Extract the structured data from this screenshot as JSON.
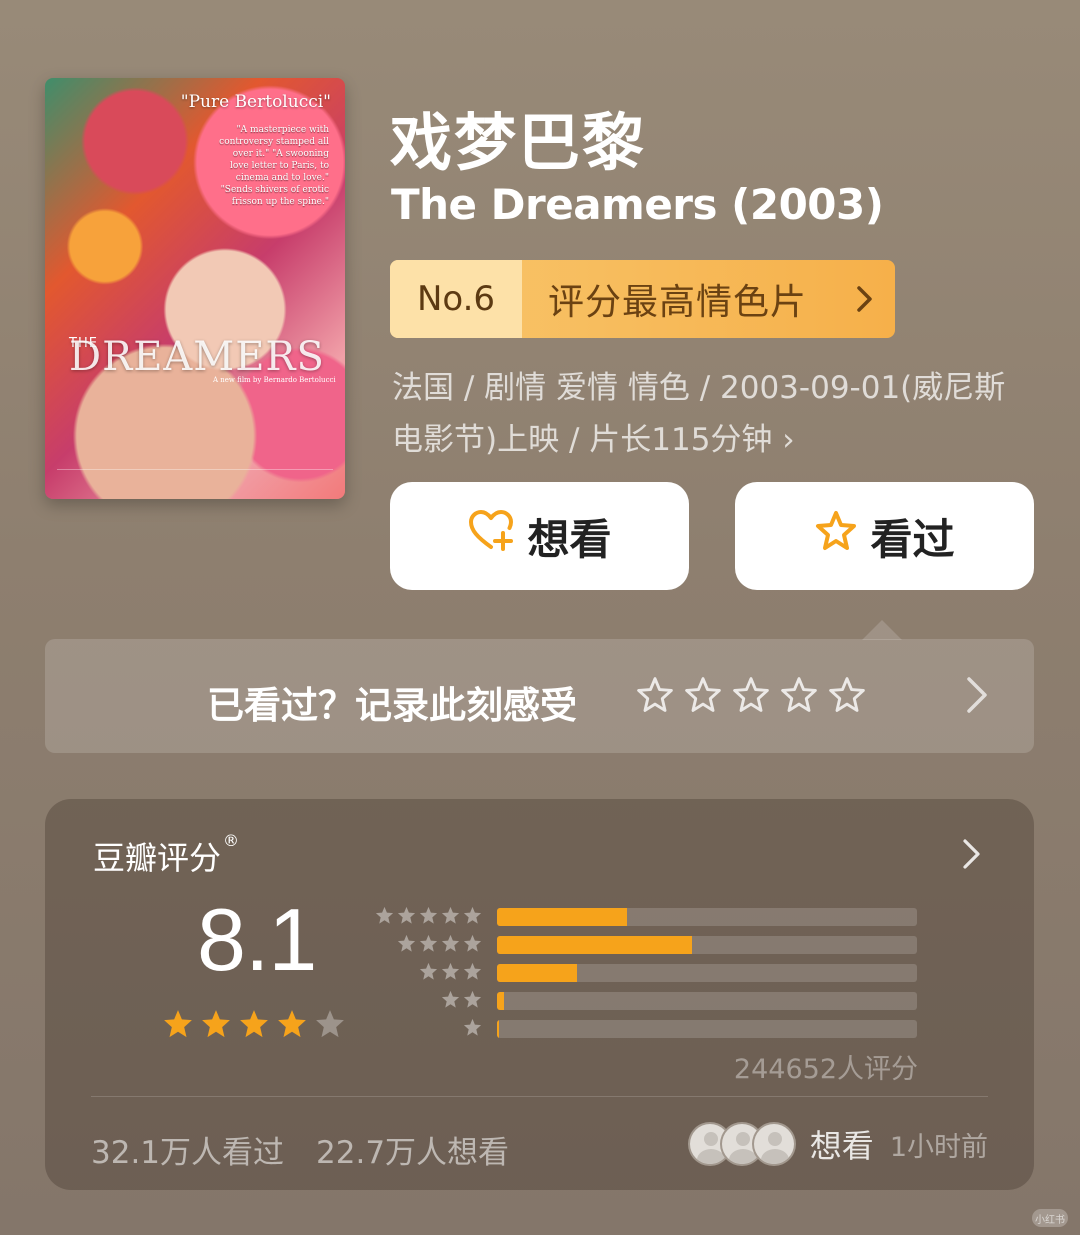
{
  "movie": {
    "title_cn": "戏梦巴黎",
    "title_en": "The Dreamers (2003)",
    "meta_line1": "法国 / 剧情 爱情 情色 / 2003-09-01(威尼斯",
    "meta_line2": "电影节)上映 / 片长115分钟 ›"
  },
  "poster": {
    "quote": "\"Pure Bertolucci\"",
    "side_text": "\"A masterpiece with controversy stamped all over it.\" \"A swooning love letter to Paris, to cinema and to love.\" \"Sends shivers of erotic frisson up the spine.\"",
    "the": "THE",
    "title": "DREAMERS",
    "credit": "A new film by Bernardo Bertolucci"
  },
  "rank": {
    "number": "No.6",
    "label": "评分最高情色片"
  },
  "actions": {
    "want_label": "想看",
    "seen_label": "看过"
  },
  "record": {
    "prompt": "已看过？记录此刻感受"
  },
  "rating": {
    "title": "豆瓣评分",
    "registered": "®",
    "score": "8.1",
    "stars_filled": 4,
    "distribution": [
      {
        "stars": 5,
        "fraction": 0.31
      },
      {
        "stars": 4,
        "fraction": 0.465
      },
      {
        "stars": 3,
        "fraction": 0.19
      },
      {
        "stars": 2,
        "fraction": 0.016
      },
      {
        "stars": 1,
        "fraction": 0.004
      }
    ],
    "count_text": "244652人评分",
    "watched_text": "32.1万人看过",
    "wanted_text": "22.7万人想看",
    "activity_label": "想看",
    "activity_time": "1小时前"
  },
  "watermark": "小红书",
  "colors": {
    "accent_orange": "#f6a31b",
    "badge_gold": "#f8c66c",
    "background": "#988a78"
  }
}
